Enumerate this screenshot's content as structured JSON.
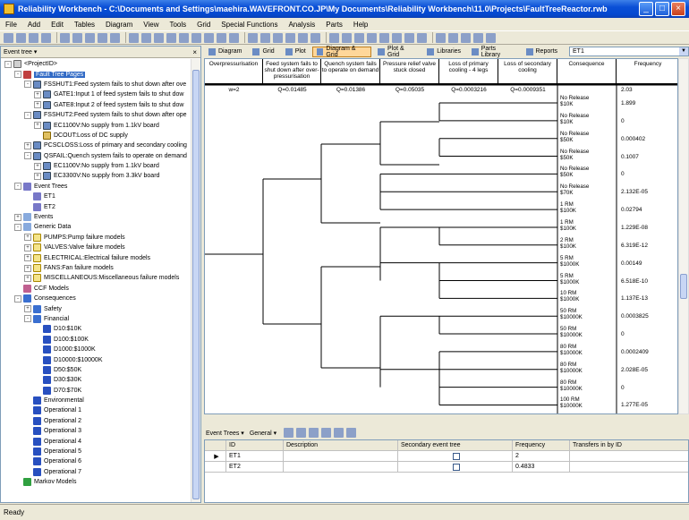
{
  "window": {
    "title": "Reliability Workbench - C:\\Documents and Settings\\maehira.WAVEFRONT.CO.JP\\My Documents\\Reliability Workbench\\11.0\\Projects\\FaultTreeReactor.rwb"
  },
  "menu": [
    "File",
    "Add",
    "Edit",
    "Tables",
    "Diagram",
    "View",
    "Tools",
    "Grid",
    "Special Functions",
    "Analysis",
    "Parts",
    "Help"
  ],
  "left_panel": {
    "title": "Event tree",
    "tree": [
      {
        "d": 0,
        "exp": "-",
        "icon": "proj",
        "label": "<ProjectID>"
      },
      {
        "d": 1,
        "exp": "-",
        "icon": "ft",
        "label": "Fault Tree Pages",
        "sel": true
      },
      {
        "d": 2,
        "exp": "-",
        "icon": "gate",
        "label": "FSSHUT1:Feed system fails to shut down after ove"
      },
      {
        "d": 3,
        "exp": "+",
        "icon": "gate",
        "label": "GATE1:Input 1 of feed system fails to shut dow"
      },
      {
        "d": 3,
        "exp": "+",
        "icon": "gate",
        "label": "GATE8:Input 2 of feed system fails to shut dow"
      },
      {
        "d": 2,
        "exp": "-",
        "icon": "gate",
        "label": "FSSHUT2:Feed system fails to shut down after ope"
      },
      {
        "d": 3,
        "exp": "+",
        "icon": "gate",
        "label": "EC1100V:No supply from 1.1kV board"
      },
      {
        "d": 3,
        "exp": "",
        "icon": "event",
        "label": "DCOUT:Loss of DC supply"
      },
      {
        "d": 2,
        "exp": "+",
        "icon": "gate",
        "label": "PCSCLOSS:Loss of primary and secondary cooling"
      },
      {
        "d": 2,
        "exp": "-",
        "icon": "gate",
        "label": "QSFAIL:Quench system fails to operate on demand"
      },
      {
        "d": 3,
        "exp": "+",
        "icon": "gate",
        "label": "EC1100V:No supply from 1.1kV board"
      },
      {
        "d": 3,
        "exp": "+",
        "icon": "gate",
        "label": "EC3300V:No supply from 3.3kV board"
      },
      {
        "d": 1,
        "exp": "-",
        "icon": "et",
        "label": "Event Trees"
      },
      {
        "d": 2,
        "exp": "",
        "icon": "et",
        "label": "ET1"
      },
      {
        "d": 2,
        "exp": "",
        "icon": "et",
        "label": "ET2"
      },
      {
        "d": 1,
        "exp": "+",
        "icon": "fold",
        "label": "Events"
      },
      {
        "d": 1,
        "exp": "-",
        "icon": "fold",
        "label": "Generic Data"
      },
      {
        "d": 2,
        "exp": "+",
        "icon": "gen",
        "label": "PUMPS:Pump failure models"
      },
      {
        "d": 2,
        "exp": "+",
        "icon": "gen",
        "label": "VALVES:Valve failure models"
      },
      {
        "d": 2,
        "exp": "+",
        "icon": "gen",
        "label": "ELECTRICAL:Electrical failure models"
      },
      {
        "d": 2,
        "exp": "+",
        "icon": "gen",
        "label": "FANS:Fan failure models"
      },
      {
        "d": 2,
        "exp": "+",
        "icon": "gen",
        "label": "MISCELLANEOUS:Miscellaneous failure models"
      },
      {
        "d": 1,
        "exp": "",
        "icon": "ccf",
        "label": "CCF Models"
      },
      {
        "d": 1,
        "exp": "-",
        "icon": "cons",
        "label": "Consequences"
      },
      {
        "d": 2,
        "exp": "+",
        "icon": "cons",
        "label": "Safety"
      },
      {
        "d": 2,
        "exp": "-",
        "icon": "cons",
        "label": "Financial"
      },
      {
        "d": 3,
        "exp": "",
        "icon": "blue",
        "label": "D10:$10K"
      },
      {
        "d": 3,
        "exp": "",
        "icon": "blue",
        "label": "D100:$100K"
      },
      {
        "d": 3,
        "exp": "",
        "icon": "blue",
        "label": "D1000:$1000K"
      },
      {
        "d": 3,
        "exp": "",
        "icon": "blue",
        "label": "D10000:$10000K"
      },
      {
        "d": 3,
        "exp": "",
        "icon": "blue",
        "label": "D50:$50K"
      },
      {
        "d": 3,
        "exp": "",
        "icon": "blue",
        "label": "D30:$30K"
      },
      {
        "d": 3,
        "exp": "",
        "icon": "blue",
        "label": "D70:$70K"
      },
      {
        "d": 2,
        "exp": "",
        "icon": "blue",
        "label": "Environmental"
      },
      {
        "d": 2,
        "exp": "",
        "icon": "blue",
        "label": "Operational 1"
      },
      {
        "d": 2,
        "exp": "",
        "icon": "blue",
        "label": "Operational 2"
      },
      {
        "d": 2,
        "exp": "",
        "icon": "blue",
        "label": "Operational 3"
      },
      {
        "d": 2,
        "exp": "",
        "icon": "blue",
        "label": "Operational 4"
      },
      {
        "d": 2,
        "exp": "",
        "icon": "blue",
        "label": "Operational 5"
      },
      {
        "d": 2,
        "exp": "",
        "icon": "blue",
        "label": "Operational 6"
      },
      {
        "d": 2,
        "exp": "",
        "icon": "blue",
        "label": "Operational 7"
      },
      {
        "d": 1,
        "exp": "",
        "icon": "markov",
        "label": "Markov Models"
      }
    ]
  },
  "tabs": [
    "Diagram",
    "Grid",
    "Plot",
    "Diagram & Grid",
    "Plot & Grid",
    "Libraries",
    "Parts Library",
    "Reports"
  ],
  "active_tab": "Diagram & Grid",
  "event_tree_select": "ET1",
  "diagram": {
    "headers": [
      "Overpressurisation",
      "Feed system fails to shut down after over-pressurisation",
      "Quench system fails to operate on demand",
      "Pressure relief valve stuck closed",
      "Loss of primary cooling - 4 legs",
      "Loss of secondary cooling",
      "Consequence",
      "Frequency"
    ],
    "values": [
      "w=2",
      "Q=0.01485",
      "Q=0.01386",
      "Q=0.05035",
      "Q=0.0003216",
      "Q=0.0009351"
    ],
    "first_frequency": "2.03",
    "consequences": [
      {
        "l1": "No Release",
        "l2": "$10K",
        "f": "1.899"
      },
      {
        "l1": "No Release",
        "l2": "$10K",
        "f": "0"
      },
      {
        "l1": "No Release",
        "l2": "$50K",
        "f": "0.000402"
      },
      {
        "l1": "No Release",
        "l2": "$50K",
        "f": "0.1007"
      },
      {
        "l1": "No Release",
        "l2": "$50K",
        "f": "0"
      },
      {
        "l1": "No Release",
        "l2": "$70K",
        "f": "2.132E-05"
      },
      {
        "l1": "1 RM",
        "l2": "$100K",
        "f": "0.02794"
      },
      {
        "l1": "1 RM",
        "l2": "$100K",
        "f": "1.229E-08"
      },
      {
        "l1": "2 RM",
        "l2": "$100K",
        "f": "6.319E-12"
      },
      {
        "l1": "5 RM",
        "l2": "$1000K",
        "f": "0.00149"
      },
      {
        "l1": "5 RM",
        "l2": "$1000K",
        "f": "6.518E-10"
      },
      {
        "l1": "10 RM",
        "l2": "$1000K",
        "f": "1.137E-13"
      },
      {
        "l1": "50 RM",
        "l2": "$10000K",
        "f": "0.0003825"
      },
      {
        "l1": "50 RM",
        "l2": "$10000K",
        "f": "0"
      },
      {
        "l1": "80 RM",
        "l2": "$10000K",
        "f": "0.0002409"
      },
      {
        "l1": "80 RM",
        "l2": "$10000K",
        "f": "2.028E-05"
      },
      {
        "l1": "80 RM",
        "l2": "$10000K",
        "f": "0"
      },
      {
        "l1": "100 RM",
        "l2": "$10000K",
        "f": "1.277E-05"
      }
    ]
  },
  "bottom_toolbar": {
    "event_trees": "Event Trees ▾",
    "general": "General ▾"
  },
  "grid": {
    "columns": [
      "ID",
      "Description",
      "Secondary event tree",
      "Frequency",
      "Transfers in by ID"
    ],
    "rows": [
      {
        "id": "ET1",
        "description": "",
        "frequency": "2",
        "transfers": ""
      },
      {
        "id": "ET2",
        "description": "",
        "frequency": "0.4833",
        "transfers": ""
      }
    ]
  },
  "status": "Ready"
}
